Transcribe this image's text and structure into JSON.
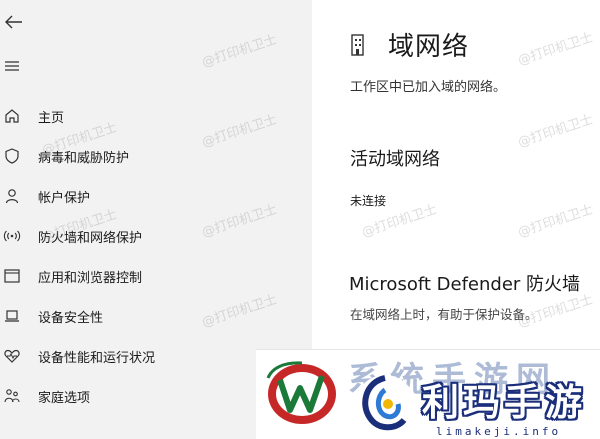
{
  "sidebar": {
    "items": [
      {
        "label": "主页",
        "icon": "home-icon"
      },
      {
        "label": "病毒和威胁防护",
        "icon": "shield-icon"
      },
      {
        "label": "帐户保护",
        "icon": "person-icon"
      },
      {
        "label": "防火墙和网络保护",
        "icon": "wifi-icon"
      },
      {
        "label": "应用和浏览器控制",
        "icon": "app-window-icon"
      },
      {
        "label": "设备安全性",
        "icon": "laptop-icon"
      },
      {
        "label": "设备性能和运行状况",
        "icon": "heart-icon"
      },
      {
        "label": "家庭选项",
        "icon": "family-icon"
      }
    ]
  },
  "main": {
    "title": "域网络",
    "description": "工作区中已加入域的网络。",
    "active_section_title": "活动域网络",
    "active_status": "未连接",
    "firewall_title": "Microsoft Defender 防火墙",
    "firewall_description": "在域网络上时，有助于保护设备。"
  },
  "watermark": {
    "text": "@打印机卫士"
  },
  "logo": {
    "ghost_text": "系统手游网",
    "name": "利玛手游",
    "subtitle": "limakeji.info"
  },
  "colors": {
    "sidebar_bg": "#f2f2f2",
    "logo_red": "#c62828",
    "logo_green": "#1b7a3a",
    "logo_blue": "#1a2e7a"
  }
}
